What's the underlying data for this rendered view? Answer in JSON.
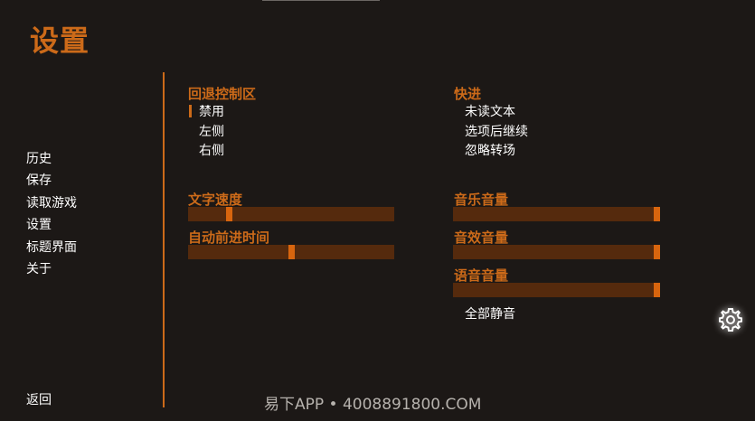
{
  "title": "设置",
  "nav": {
    "items": [
      "历史",
      "保存",
      "读取游戏",
      "设置",
      "标题界面",
      "关于"
    ],
    "active": "设置",
    "return_label": "返回"
  },
  "rollback": {
    "label": "回退控制区",
    "options": [
      "禁用",
      "左侧",
      "右侧"
    ],
    "selected": "禁用"
  },
  "skip": {
    "label": "快进",
    "options": [
      "未读文本",
      "选项后继续",
      "忽略转场"
    ]
  },
  "text_speed": {
    "label": "文字速度",
    "value": 0.2
  },
  "auto_forward": {
    "label": "自动前进时间",
    "value": 0.5
  },
  "music_volume": {
    "label": "音乐音量",
    "value": 1.0
  },
  "sound_volume": {
    "label": "音效音量",
    "value": 1.0
  },
  "voice_volume": {
    "label": "语音音量",
    "value": 1.0
  },
  "mute_all": "全部静音",
  "watermark": "易下APP • 4008891800.COM",
  "colors": {
    "background": "#1c1816",
    "accent": "#cc6a19",
    "slider_track": "#552a0d",
    "slider_thumb": "#d8650e"
  },
  "icons": {
    "gear": "gear-icon"
  }
}
